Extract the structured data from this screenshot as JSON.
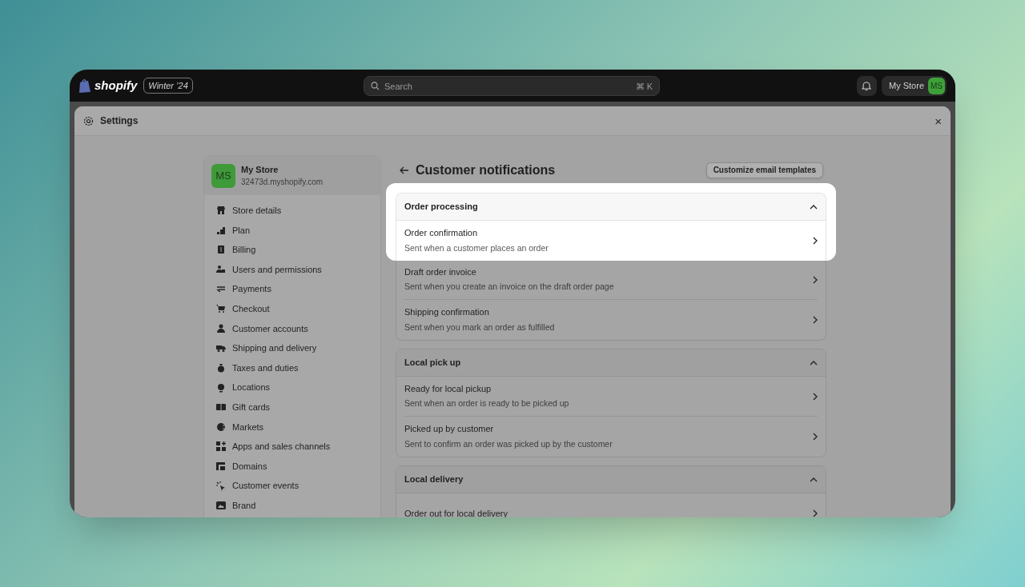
{
  "topbar": {
    "logo": "shopify",
    "badge": "Winter ’24",
    "search": {
      "placeholder": "Search",
      "shortcut": "⌘ K"
    },
    "store_button": "My Store",
    "avatar": "MS"
  },
  "modal": {
    "title": "Settings",
    "close": "×"
  },
  "store": {
    "avatar": "MS",
    "name": "My Store",
    "domain": "32473d.myshopify.com"
  },
  "sidebar": {
    "items": [
      {
        "label": "Store details"
      },
      {
        "label": "Plan"
      },
      {
        "label": "Billing"
      },
      {
        "label": "Users and permissions"
      },
      {
        "label": "Payments"
      },
      {
        "label": "Checkout"
      },
      {
        "label": "Customer accounts"
      },
      {
        "label": "Shipping and delivery"
      },
      {
        "label": "Taxes and duties"
      },
      {
        "label": "Locations"
      },
      {
        "label": "Gift cards"
      },
      {
        "label": "Markets"
      },
      {
        "label": "Apps and sales channels"
      },
      {
        "label": "Domains"
      },
      {
        "label": "Customer events"
      },
      {
        "label": "Brand"
      }
    ]
  },
  "page": {
    "title": "Customer notifications",
    "action": "Customize email templates"
  },
  "sections": [
    {
      "title": "Order processing",
      "expanded": true,
      "items": [
        {
          "title": "Order confirmation",
          "description": "Sent when a customer places an order",
          "highlighted": true
        },
        {
          "title": "Draft order invoice",
          "description": "Sent when you create an invoice on the draft order page",
          "highlighted": false
        },
        {
          "title": "Shipping confirmation",
          "description": "Sent when you mark an order as fulfilled",
          "highlighted": false
        }
      ]
    },
    {
      "title": "Local pick up",
      "expanded": true,
      "items": [
        {
          "title": "Ready for local pickup",
          "description": "Sent when an order is ready to be picked up",
          "highlighted": false
        },
        {
          "title": "Picked up by customer",
          "description": "Sent to confirm an order was picked up by the customer",
          "highlighted": false
        }
      ]
    },
    {
      "title": "Local delivery",
      "expanded": true,
      "items": [
        {
          "title": "Order out for local delivery",
          "highlighted": false
        }
      ]
    }
  ]
}
